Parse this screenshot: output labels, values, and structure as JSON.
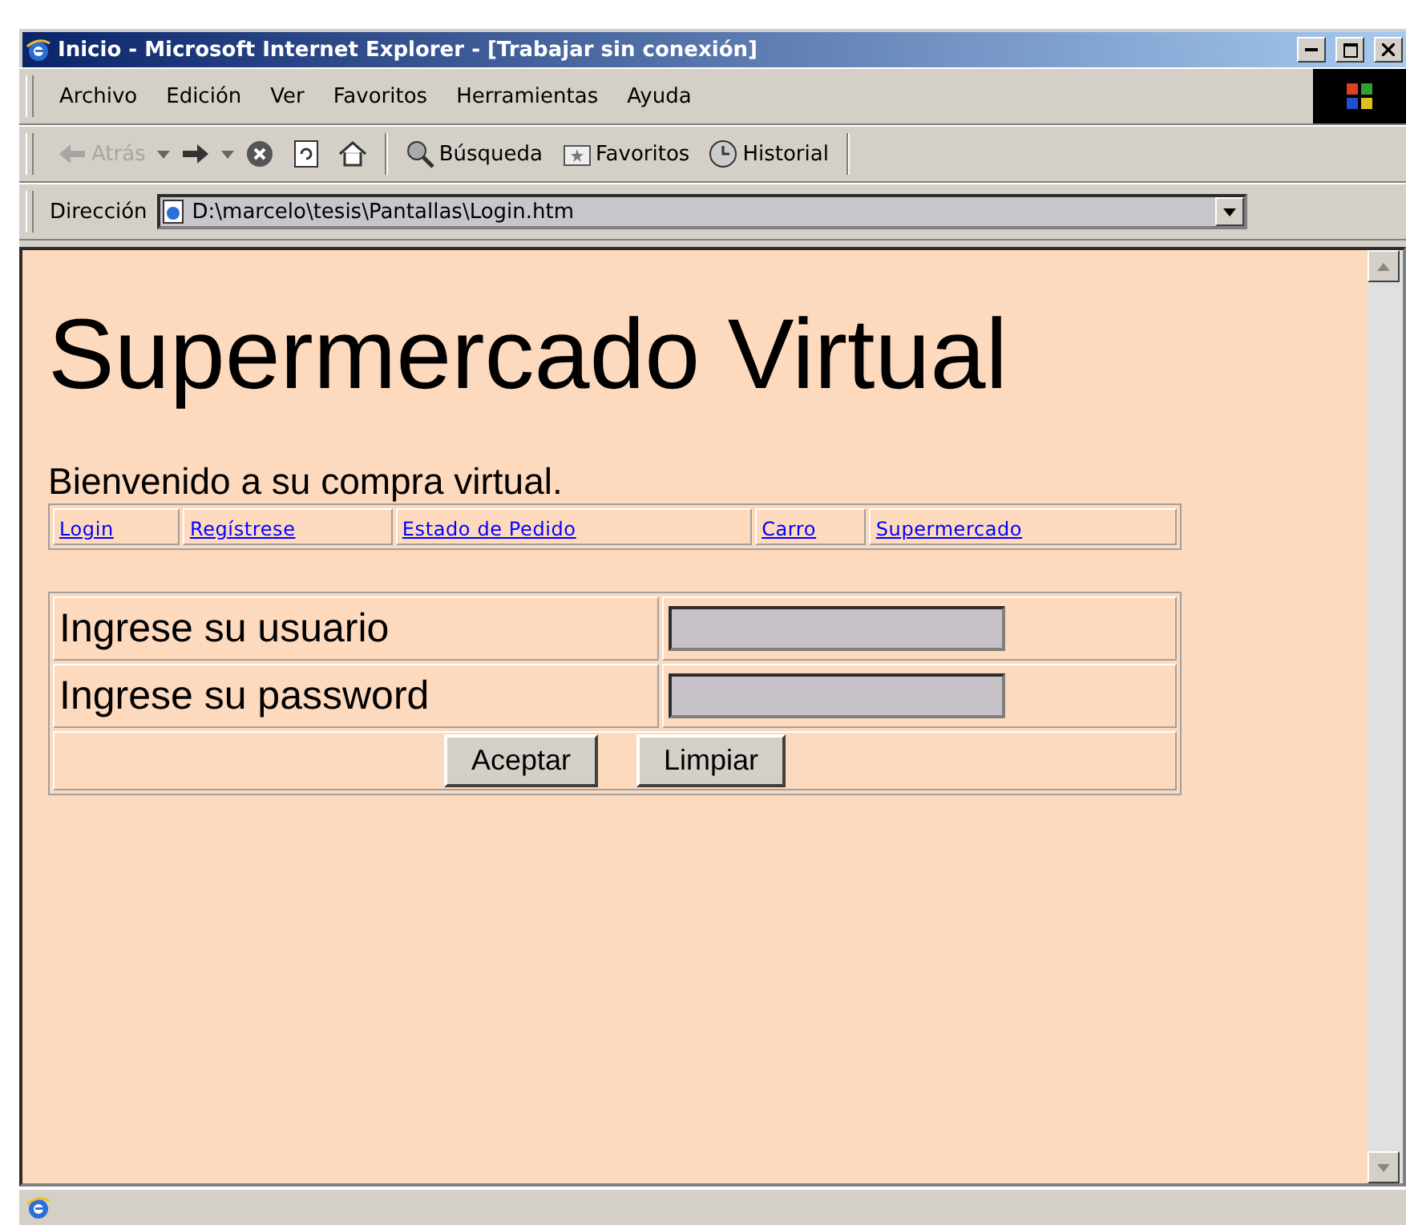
{
  "window": {
    "title": "Inicio - Microsoft Internet Explorer - [Trabajar sin conexión]"
  },
  "menu": [
    "Archivo",
    "Edición",
    "Ver",
    "Favoritos",
    "Herramientas",
    "Ayuda"
  ],
  "toolbar": [
    {
      "kind": "back",
      "label": "Atrás",
      "disabled": true
    },
    {
      "kind": "forward",
      "disabled": false
    },
    {
      "kind": "stop",
      "disabled": false
    },
    {
      "kind": "refresh",
      "disabled": false
    },
    {
      "kind": "home",
      "disabled": false
    },
    {
      "kind": "search",
      "label": "Búsqueda",
      "disabled": false
    },
    {
      "kind": "favorites",
      "label": "Favoritos",
      "disabled": false
    },
    {
      "kind": "history",
      "label": "Historial",
      "disabled": false
    }
  ],
  "address": {
    "label": "Dirección",
    "value": "D:\\marcelo\\tesis\\Pantallas\\Login.htm"
  },
  "page": {
    "heading": "Supermercado Virtual",
    "welcome": "Bienvenido a su compra virtual.",
    "nav_links": [
      "Login",
      "Regístrese",
      "Estado de Pedido",
      "Carro",
      "Supermercado"
    ],
    "form": {
      "fields": [
        {
          "label": "Ingrese su usuario"
        },
        {
          "label": "Ingrese su password"
        }
      ],
      "buttons": [
        "Aceptar",
        "Limpiar"
      ]
    }
  }
}
